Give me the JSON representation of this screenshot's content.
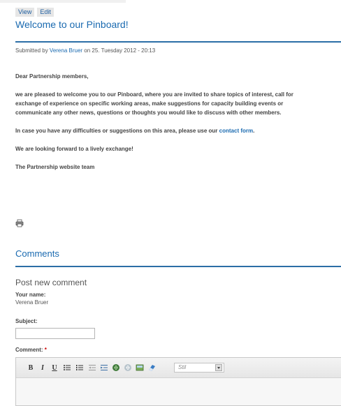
{
  "tabs": [
    {
      "label": "View"
    },
    {
      "label": "Edit"
    }
  ],
  "node": {
    "title": "Welcome to our Pinboard!",
    "submitted": {
      "prefix": "Submitted by ",
      "author": "Verena Bruer",
      "suffix": " on 25. Tuesday 2012 - 20:13"
    },
    "body": {
      "greeting": "Dear Partnership members,",
      "paragraph1_line1": "we are pleased to welcome you to our Pinboard, where you are invited to share topics of interest, call for",
      "paragraph1_line2": "exchange of experience on specific working areas, make suggestions for capacity building events or",
      "paragraph1_line3": "communicate any other news, questions or thoughts you would like to discuss with other members.",
      "paragraph2_prefix": "In case you have any difficulties or suggestions on this area, please use our ",
      "paragraph2_link": "contact form",
      "paragraph2_suffix": ".",
      "paragraph3": "We are looking forward to a lively exchange!",
      "signature": "The Partnership website team"
    }
  },
  "icons": {
    "print": "printer-icon"
  },
  "comments": {
    "heading": "Comments",
    "form": {
      "title": "Post new comment",
      "name_label": "Your name:",
      "name_value": "Verena Bruer",
      "subject_label": "Subject:",
      "subject_value": "",
      "comment_label": "Comment:",
      "required_marker": "*",
      "toolbar": {
        "bold": "B",
        "italic": "I",
        "underline": "U",
        "style_placeholder": "Stil"
      }
    }
  },
  "colors": {
    "link": "#1a6ab0",
    "rule": "#2b6ea6",
    "required": "#cc0000"
  }
}
